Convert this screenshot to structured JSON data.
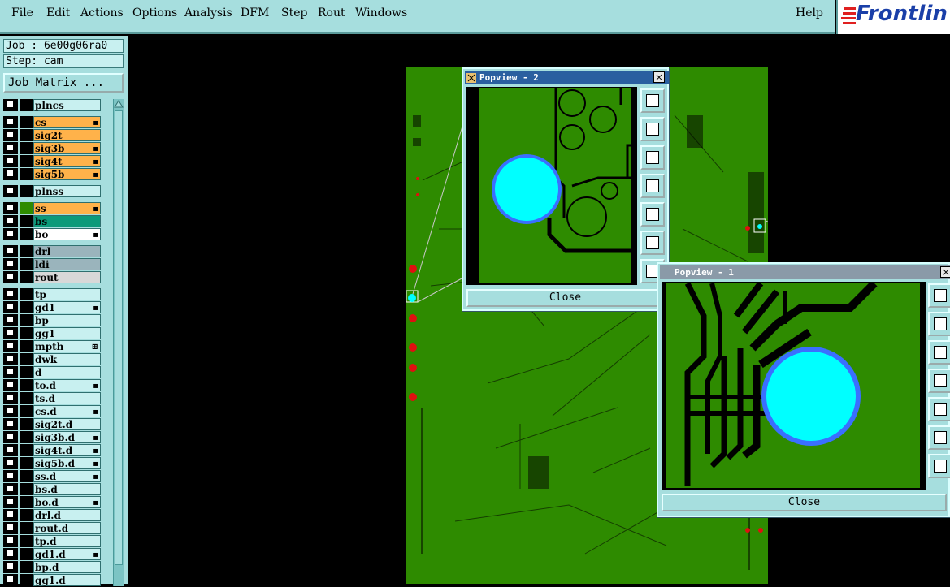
{
  "menu": {
    "items": [
      "File",
      "Edit",
      "Actions",
      "Options",
      "Analysis",
      "DFM",
      "Step",
      "Rout",
      "Windows"
    ],
    "help": "Help"
  },
  "logo": {
    "text": "Frontlin"
  },
  "job": {
    "label": "Job : 6e00g06ra0",
    "step": "Step: cam",
    "matrix_button": "Job Matrix ..."
  },
  "layers": [
    {
      "name": "plncs",
      "color": "#c8f0f0",
      "gap": false,
      "flag": ""
    },
    {
      "name": "cs",
      "color": "#ffb24a",
      "gap": true,
      "flag": "▪"
    },
    {
      "name": "sig2t",
      "color": "#ffb24a",
      "gap": false,
      "flag": ""
    },
    {
      "name": "sig3b",
      "color": "#ffb24a",
      "gap": false,
      "flag": "▪"
    },
    {
      "name": "sig4t",
      "color": "#ffb24a",
      "gap": false,
      "flag": "▪"
    },
    {
      "name": "sig5b",
      "color": "#ffb24a",
      "gap": false,
      "flag": "▪"
    },
    {
      "name": "plnss",
      "color": "#c8f0f0",
      "gap": true,
      "flag": ""
    },
    {
      "name": "ss",
      "color": "#ffb24a",
      "gap": true,
      "flag": "▪"
    },
    {
      "name": "bs",
      "color": "#0c9a7a",
      "gap": false,
      "flag": ""
    },
    {
      "name": "bo",
      "color": "#ffffff",
      "gap": false,
      "flag": "▪"
    },
    {
      "name": "drl",
      "color": "#9ab4bc",
      "gap": true,
      "flag": ""
    },
    {
      "name": "ldi",
      "color": "#9ab4bc",
      "gap": false,
      "flag": ""
    },
    {
      "name": "rout",
      "color": "#d8d8d8",
      "gap": false,
      "flag": ""
    },
    {
      "name": "tp",
      "color": "#c8f0f0",
      "gap": true,
      "flag": ""
    },
    {
      "name": "gd1",
      "color": "#c8f0f0",
      "gap": false,
      "flag": "▪"
    },
    {
      "name": "bp",
      "color": "#c8f0f0",
      "gap": false,
      "flag": ""
    },
    {
      "name": "gg1",
      "color": "#c8f0f0",
      "gap": false,
      "flag": ""
    },
    {
      "name": "mpth",
      "color": "#c8f0f0",
      "gap": false,
      "flag": "⊞"
    },
    {
      "name": "dwk",
      "color": "#c8f0f0",
      "gap": false,
      "flag": ""
    },
    {
      "name": "d",
      "color": "#c8f0f0",
      "gap": false,
      "flag": ""
    },
    {
      "name": "to.d",
      "color": "#c8f0f0",
      "gap": false,
      "flag": "▪"
    },
    {
      "name": "ts.d",
      "color": "#c8f0f0",
      "gap": false,
      "flag": ""
    },
    {
      "name": "cs.d",
      "color": "#c8f0f0",
      "gap": false,
      "flag": "▪"
    },
    {
      "name": "sig2t.d",
      "color": "#c8f0f0",
      "gap": false,
      "flag": ""
    },
    {
      "name": "sig3b.d",
      "color": "#c8f0f0",
      "gap": false,
      "flag": "▪"
    },
    {
      "name": "sig4t.d",
      "color": "#c8f0f0",
      "gap": false,
      "flag": "▪"
    },
    {
      "name": "sig5b.d",
      "color": "#c8f0f0",
      "gap": false,
      "flag": "▪"
    },
    {
      "name": "ss.d",
      "color": "#c8f0f0",
      "gap": false,
      "flag": "▪"
    },
    {
      "name": "bs.d",
      "color": "#c8f0f0",
      "gap": false,
      "flag": ""
    },
    {
      "name": "bo.d",
      "color": "#c8f0f0",
      "gap": false,
      "flag": "▪"
    },
    {
      "name": "drl.d",
      "color": "#c8f0f0",
      "gap": false,
      "flag": ""
    },
    {
      "name": "rout.d",
      "color": "#c8f0f0",
      "gap": false,
      "flag": ""
    },
    {
      "name": "tp.d",
      "color": "#c8f0f0",
      "gap": false,
      "flag": ""
    },
    {
      "name": "gd1.d",
      "color": "#c8f0f0",
      "gap": false,
      "flag": "▪"
    },
    {
      "name": "bp.d",
      "color": "#c8f0f0",
      "gap": false,
      "flag": ""
    },
    {
      "name": "gg1.d",
      "color": "#c8f0f0",
      "gap": false,
      "flag": ""
    }
  ],
  "popview2": {
    "title": "Popview - 2",
    "close_label": "Close",
    "close_x": "×"
  },
  "popview1": {
    "title": "Popview - 1",
    "close_label": "Close",
    "close_x": "×"
  },
  "colors": {
    "panel": "#a6dede",
    "board": "#2e8b00",
    "pad": "#00ffff",
    "pad_ring": "#3a6fff",
    "titlebar": "#2a5fa0"
  }
}
